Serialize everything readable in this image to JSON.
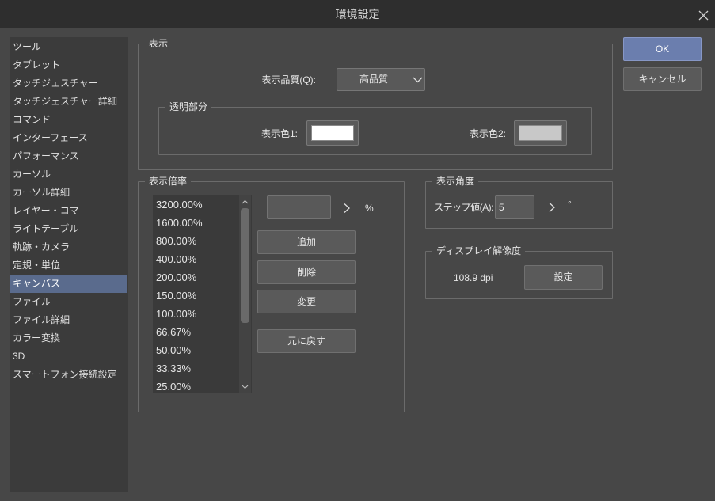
{
  "window": {
    "title": "環境設定",
    "close_icon": "close-icon"
  },
  "colors": {
    "background": "#474747",
    "titlebar": "#2e2e2e",
    "sidebar": "#3b3b3b",
    "selection": "#5a6b8d",
    "accent": "#6b7eae",
    "text": "#e6e6e6"
  },
  "sidebar": {
    "selected_index": 13,
    "items": [
      "ツール",
      "タブレット",
      "タッチジェスチャー",
      "タッチジェスチャー詳細",
      "コマンド",
      "インターフェース",
      "パフォーマンス",
      "カーソル",
      "カーソル詳細",
      "レイヤー・コマ",
      "ライトテーブル",
      "軌跡・カメラ",
      "定規・単位",
      "キャンバス",
      "ファイル",
      "ファイル詳細",
      "カラー変換",
      "3D",
      "スマートフォン接続設定"
    ]
  },
  "actions": {
    "ok": "OK",
    "cancel": "キャンセル"
  },
  "display": {
    "group_label": "表示",
    "quality_label": "表示品質(Q):",
    "quality_value": "高品質",
    "quality_dropdown_icon": "chevron-down-icon",
    "transparency": {
      "group_label": "透明部分",
      "color1_label": "表示色1:",
      "color1_value": "#ffffff",
      "color2_label": "表示色2:",
      "color2_value": "#c8c8c8"
    }
  },
  "zoom": {
    "group_label": "表示倍率",
    "values": [
      "3200.00%",
      "1600.00%",
      "800.00%",
      "400.00%",
      "200.00%",
      "150.00%",
      "100.00%",
      "66.67%",
      "50.00%",
      "33.33%",
      "25.00%"
    ],
    "step_icon": "chevron-right-icon",
    "unit": "%",
    "add_button": "追加",
    "delete_button": "削除",
    "change_button": "変更",
    "reset_button": "元に戻す"
  },
  "rotation": {
    "group_label": "表示角度",
    "step_label": "ステップ値(A):",
    "step_value": "5",
    "step_icon": "chevron-right-icon",
    "unit": "°"
  },
  "resolution": {
    "group_label": "ディスプレイ解像度",
    "value": "108.9 dpi",
    "set_button": "設定"
  }
}
